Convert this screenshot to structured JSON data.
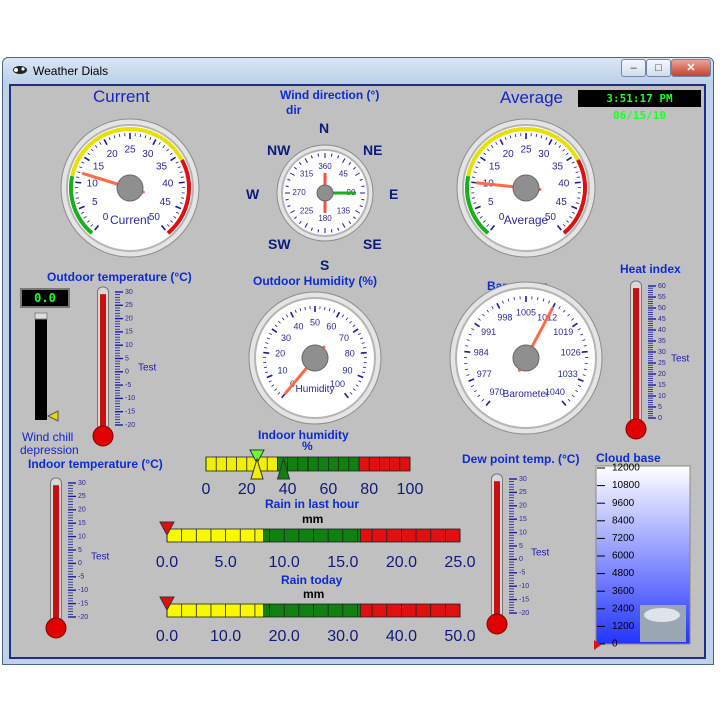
{
  "window": {
    "title": "Weather Dials",
    "icon": "weather-app-icon",
    "controls": {
      "minimize": "–",
      "maximize": "□",
      "close": "✕"
    }
  },
  "clock": "3:51:17 PM 06/15/10",
  "current_gauge": {
    "label": "Current",
    "inner_label": "Current",
    "ticks": [
      "0",
      "5",
      "10",
      "15",
      "20",
      "25",
      "30",
      "35",
      "40",
      "45",
      "50"
    ],
    "value": 12
  },
  "average_gauge": {
    "label": "Average",
    "inner_label": "Average",
    "ticks": [
      "0",
      "5",
      "10",
      "15",
      "20",
      "25",
      "30",
      "35",
      "40",
      "45",
      "50"
    ],
    "value": 10
  },
  "wind_direction": {
    "title": "Wind direction (°)",
    "subtitle": "dir",
    "compass": [
      "N",
      "NE",
      "E",
      "SE",
      "S",
      "SW",
      "W",
      "NW"
    ],
    "ticks": [
      "360",
      "45",
      "90",
      "135",
      "180",
      "225",
      "270",
      "315"
    ],
    "direction_degrees": 90
  },
  "outdoor_humidity": {
    "title": "Outdoor Humidity (%)",
    "inner_label": "Humidity",
    "ticks": [
      "0",
      "10",
      "20",
      "30",
      "40",
      "50",
      "60",
      "70",
      "80",
      "90",
      "100"
    ],
    "value": 0
  },
  "barometer": {
    "title": "Barometer",
    "inner_label": "Barometer",
    "ticks": [
      "970",
      "977",
      "984",
      "991",
      "998",
      "1005",
      "1012",
      "1019",
      "1026",
      "1033",
      "1040"
    ],
    "value": 1012
  },
  "outdoor_temperature": {
    "title": "Outdoor temperature (°C)",
    "tag": "Test",
    "ticks": [
      "30",
      "25",
      "20",
      "15",
      "10",
      "5",
      "0",
      "-5",
      "-10",
      "-15",
      "-20"
    ],
    "level_fraction": 0.95
  },
  "wind_chill": {
    "display": "0.0",
    "label_line1": "Wind chill",
    "label_line2": "depression",
    "level_fraction": 0.0
  },
  "heat_index": {
    "title": "Heat index",
    "tag": "Test",
    "ticks": [
      "60",
      "55",
      "50",
      "45",
      "40",
      "35",
      "30",
      "25",
      "20",
      "15",
      "10",
      "5",
      "0"
    ],
    "level_fraction": 0.95
  },
  "indoor_temperature": {
    "title": "Indoor temperature (°C)",
    "tag": "Test",
    "ticks": [
      "30",
      "25",
      "20",
      "15",
      "10",
      "5",
      "0",
      "-5",
      "-10",
      "-15",
      "-20"
    ],
    "level_fraction": 0.95
  },
  "dew_point": {
    "title": "Dew point temp. (°C)",
    "tag": "Test",
    "ticks": [
      "30",
      "25",
      "20",
      "15",
      "10",
      "5",
      "0",
      "-5",
      "-10",
      "-15",
      "-20"
    ],
    "level_fraction": 0.95
  },
  "indoor_humidity": {
    "title": "Indoor humidity",
    "unit": "%",
    "ticks": [
      "0",
      "20",
      "40",
      "60",
      "80",
      "100"
    ],
    "pointers": [
      25,
      38
    ]
  },
  "rain_last_hour": {
    "title": "Rain in last hour",
    "unit": "mm",
    "ticks": [
      "0.0",
      "5.0",
      "10.0",
      "15.0",
      "20.0",
      "25.0"
    ],
    "value": 0.0
  },
  "rain_today": {
    "title": "Rain today",
    "unit": "mm",
    "ticks": [
      "0.0",
      "10.0",
      "20.0",
      "30.0",
      "40.0",
      "50.0"
    ],
    "value": 0.0
  },
  "cloud_base": {
    "title": "Cloud base",
    "ticks": [
      "12000",
      "10800",
      "9600",
      "8400",
      "7200",
      "6000",
      "4800",
      "3600",
      "2400",
      "1200",
      "0"
    ],
    "value": 0
  },
  "colors": {
    "label_blue": "#0c2bd0",
    "dial_red": "#e01010",
    "dial_yellow": "#e8e000",
    "dial_green": "#18b018",
    "display_green": "#1cff2a"
  }
}
